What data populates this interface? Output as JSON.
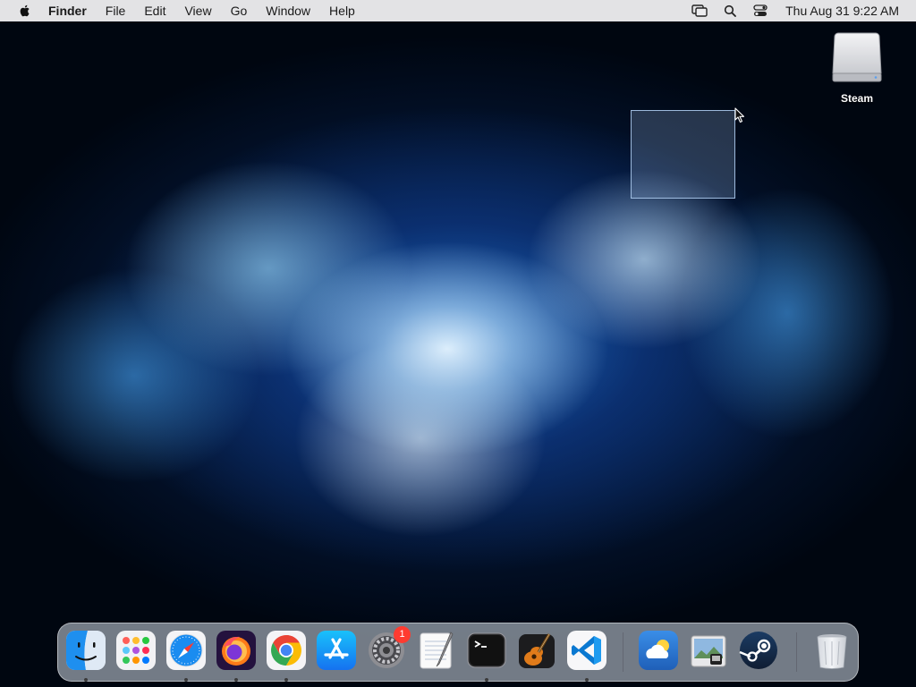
{
  "menubar": {
    "apple": "apple-icon",
    "app_name": "Finder",
    "menus": [
      "File",
      "Edit",
      "View",
      "Go",
      "Window",
      "Help"
    ],
    "clock": "Thu Aug 31  9:22 AM",
    "tray_icons": [
      "screen-mirroring-icon",
      "search-icon",
      "control-center-icon"
    ]
  },
  "desktop": {
    "icons": [
      {
        "label": "Steam",
        "icon": "external-drive-icon"
      }
    ]
  },
  "dock": {
    "apps": [
      {
        "name": "finder-icon",
        "running": true
      },
      {
        "name": "launchpad-icon",
        "running": false
      },
      {
        "name": "safari-icon",
        "running": true
      },
      {
        "name": "firefox-icon",
        "running": true
      },
      {
        "name": "chrome-icon",
        "running": true
      },
      {
        "name": "app-store-icon",
        "running": false
      },
      {
        "name": "system-preferences-icon",
        "running": false,
        "badge": "1"
      },
      {
        "name": "textedit-icon",
        "running": false
      },
      {
        "name": "terminal-icon",
        "running": true
      },
      {
        "name": "garageband-icon",
        "running": false
      },
      {
        "name": "vscode-icon",
        "running": true
      },
      {
        "name": "weather-icon",
        "running": false
      },
      {
        "name": "preview-icon",
        "running": false
      },
      {
        "name": "steam-icon",
        "running": false
      },
      {
        "name": "trash-icon",
        "running": false
      }
    ]
  },
  "colors": {
    "menubar_bg": "#ececee",
    "badge_red": "#ff3b30",
    "selection_border": "#aac8eb"
  }
}
